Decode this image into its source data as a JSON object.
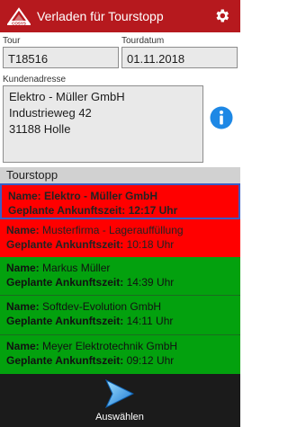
{
  "app": {
    "title": "Verladen für Tourstopp"
  },
  "form": {
    "tour_label": "Tour",
    "tour_value": "T18516",
    "date_label": "Tourdatum",
    "date_value": "01.11.2018",
    "address_label": "Kundenadresse",
    "address_value": "Elektro - Müller GmbH\nIndustrieweg 42\n31188 Holle"
  },
  "tourstopp": {
    "header": "Tourstopp",
    "name_key": "Name:",
    "time_key": "Geplante Ankunftszeit:",
    "items": [
      {
        "name": "Elektro - Müller GmbH",
        "time": "12:17 Uhr",
        "status": "red",
        "selected": true
      },
      {
        "name": "Musterfirma - Lagerauffüllung",
        "time": "10:18 Uhr",
        "status": "red",
        "selected": false
      },
      {
        "name": "Markus Müller",
        "time": "14:39 Uhr",
        "status": "green",
        "selected": false
      },
      {
        "name": "Softdev-Evolution GmbH",
        "time": "14:11 Uhr",
        "status": "green",
        "selected": false
      },
      {
        "name": "Meyer Elektrotechnik GmbH",
        "time": "09:12 Uhr",
        "status": "green",
        "selected": false
      }
    ]
  },
  "bottom": {
    "select_label": "Auswählen"
  },
  "colors": {
    "appbar": "#b6191e",
    "status_red": "#ff0000",
    "status_green": "#03a10e",
    "selection_border": "#3a5cc6"
  }
}
